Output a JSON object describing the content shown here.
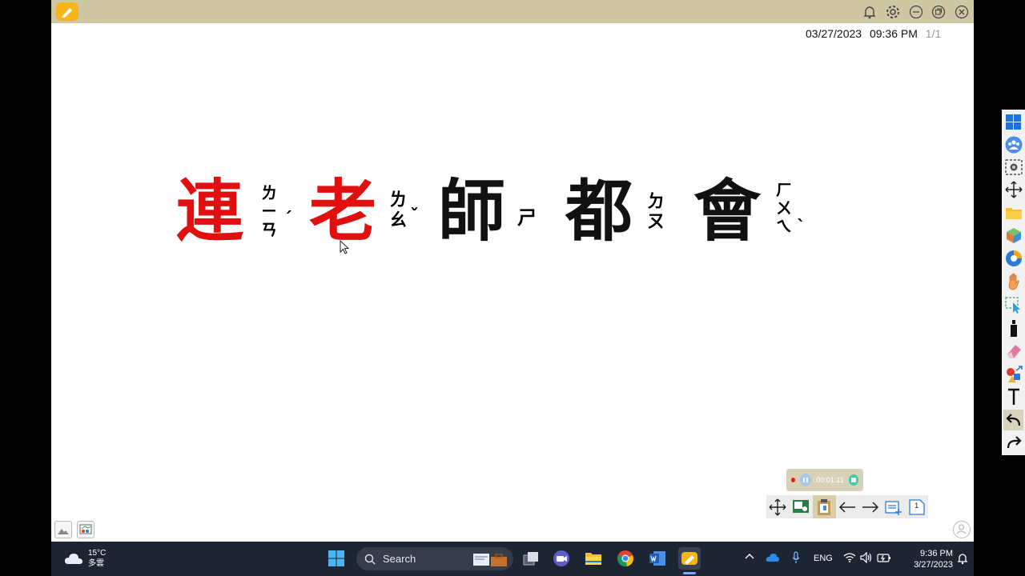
{
  "window": {
    "date": "03/27/2023",
    "time": "09:36 PM",
    "page": "1/1"
  },
  "board": {
    "characters": [
      {
        "char": "連",
        "zhuyin": "ㄌㄧㄢ",
        "tone": "ˊ"
      },
      {
        "char": "老",
        "zhuyin": "ㄌㄠ",
        "tone": "ˇ"
      },
      {
        "char": "師",
        "zhuyin": "ㄕ",
        "tone": ""
      },
      {
        "char": "都",
        "zhuyin": "ㄉㄡ",
        "tone": ""
      },
      {
        "char": "會",
        "zhuyin": "ㄏㄨㄟ",
        "tone": "ˋ"
      }
    ]
  },
  "recorder": {
    "elapsed": "00:01:11"
  },
  "page_badge": "1",
  "taskbar": {
    "weather_temp": "15°C",
    "weather_desc": "多雲",
    "search_placeholder": "Search",
    "language": "ENG",
    "clock_time": "9:36 PM",
    "clock_date": "3/27/2023"
  },
  "colors": {
    "titlebar": "#cfc7a3",
    "ink_red": "#e01010",
    "ink_black": "#111111",
    "taskbar": "#1d2432"
  }
}
